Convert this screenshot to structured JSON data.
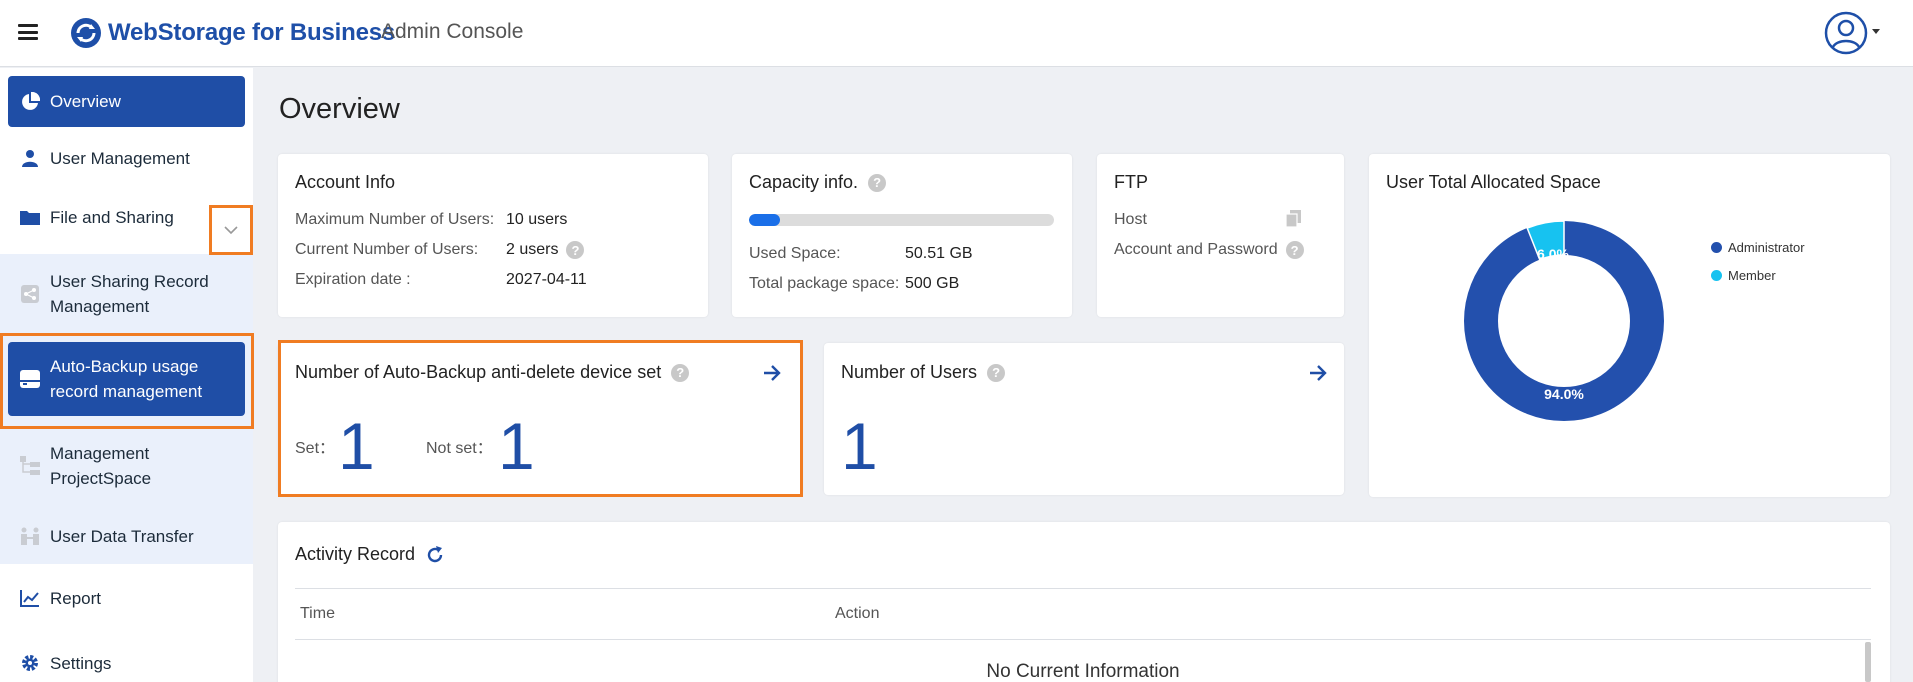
{
  "header": {
    "brand": "WebStorage for Business",
    "subtitle": "Admin Console",
    "brand_color": "#1e4fa8"
  },
  "sidebar": {
    "items": [
      {
        "label": "Overview",
        "icon": "pie-chart-icon",
        "active": true
      },
      {
        "label": "User Management",
        "icon": "user-icon"
      },
      {
        "label": "File and Sharing",
        "icon": "folder-icon",
        "expanded": true
      },
      {
        "label": "User Sharing Record Management",
        "icon": "share-icon",
        "sub": true
      },
      {
        "label": "Auto-Backup usage record management",
        "icon": "drive-icon",
        "sub": true,
        "active": true
      },
      {
        "label": "Management ProjectSpace",
        "icon": "project-tree-icon",
        "sub": true
      },
      {
        "label": "User Data Transfer",
        "icon": "transfer-icon",
        "sub": true
      },
      {
        "label": "Report",
        "icon": "line-chart-icon"
      },
      {
        "label": "Settings",
        "icon": "gear-icon"
      }
    ],
    "active_color": "#1f4ea6",
    "highlight_color": "#f07c22"
  },
  "main": {
    "title": "Overview",
    "account_info": {
      "title": "Account Info",
      "max_users_label": "Maximum Number of Users:",
      "max_users_value": "10 users",
      "current_users_label": "Current Number of Users:",
      "current_users_value": "2 users",
      "expiration_label": "Expiration date :",
      "expiration_value": "2027-04-11"
    },
    "capacity": {
      "title": "Capacity info.",
      "used_fraction": 0.101,
      "used_label": "Used Space:",
      "used_value": "50.51 GB",
      "total_label": "Total package space:",
      "total_value": "500 GB"
    },
    "ftp": {
      "title": "FTP",
      "host_label": "Host",
      "account_label": "Account and Password"
    },
    "allocated": {
      "title": "User Total Allocated Space",
      "legend": [
        {
          "name": "Administrator",
          "color": "#2350ad"
        },
        {
          "name": "Member",
          "color": "#17c2f0"
        }
      ],
      "admin_percent": 94.0,
      "member_percent": 6.0,
      "admin_label": "94.0%",
      "member_label": "6.0%"
    },
    "autobackup": {
      "title": "Number of Auto-Backup anti-delete device set",
      "set_label": "Set：",
      "set_value": "1",
      "notset_label": "Not set：",
      "notset_value": "1"
    },
    "users": {
      "title": "Number of Users",
      "value": "1"
    },
    "activity": {
      "title": "Activity Record",
      "col_time": "Time",
      "col_action": "Action",
      "empty": "No Current Information"
    }
  }
}
